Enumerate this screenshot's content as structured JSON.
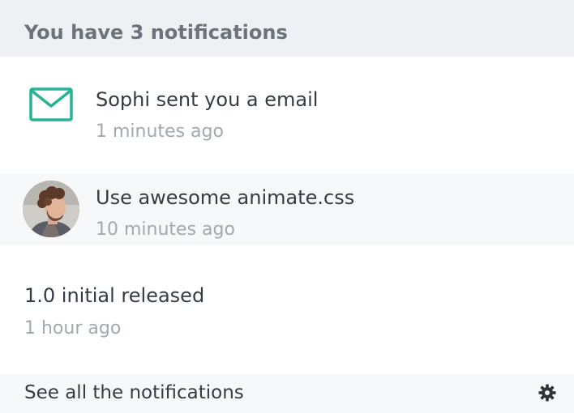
{
  "header": {
    "title": "You have 3 notifications"
  },
  "notifications": [
    {
      "icon": "envelope-icon",
      "title": "Sophi sent you a email",
      "time": "1 minutes ago"
    },
    {
      "icon": "avatar",
      "title": "Use awesome animate.css",
      "time": "10 minutes ago"
    },
    {
      "icon": "",
      "title": "1.0 initial released",
      "time": "1 hour ago"
    }
  ],
  "footer": {
    "label": "See all the notifications",
    "icon": "gear-icon"
  },
  "colors": {
    "accent": "#26b394",
    "header_bg": "#eef0f4",
    "row_bg": "#f7f8fa"
  }
}
